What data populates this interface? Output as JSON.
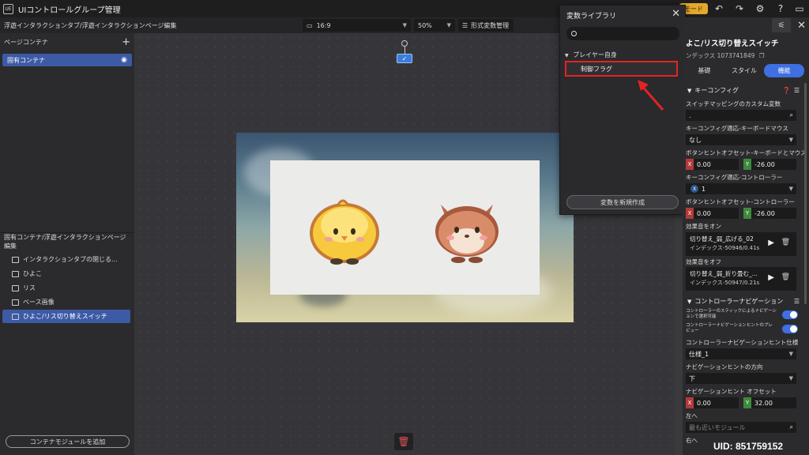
{
  "titlebar": {
    "app_icon": "UE",
    "title": "UIコントロールグループ管理",
    "mode_chip": "モード"
  },
  "toolbar": {
    "breadcrumb": "浮遊インタラクションタブ/浮遊インタラクションページ編集",
    "aspect": "16:9",
    "zoom": "50%",
    "format_vars": "形式変数管理"
  },
  "left_panel": {
    "header": "ページコンテナ",
    "container_item": "固有コンテナ",
    "section2_header": "固有コンテナ/浮遊インタラクションページ編集",
    "tree_items": [
      "インタラクションタブの閉じる...",
      "ひよこ",
      "リス",
      "ベース画像",
      "ひよこ/リス切り替えスイッチ"
    ],
    "add_module": "コンテナモジュールを追加"
  },
  "var_library": {
    "title": "変数ライブラリ",
    "group": "プレイヤー自身",
    "item": "制御フラグ",
    "new_button": "変数を新規作成"
  },
  "right_panel": {
    "name": "よこ/リス切り替えスイッチ",
    "index": "ンデックス 1073741849",
    "tabs": [
      "基礎",
      "スタイル",
      "機能"
    ],
    "key_config": "キーコンフィグ",
    "custom_var_label": "スイッチマッピングのカスタム変数",
    "custom_var_value": ".",
    "kb_label": "キーコンフィグ適応-キーボードマウス",
    "kb_value": "なし",
    "kb_offset_label": "ボタンヒントオフセット-キーボードとマウス",
    "kb_offset_x": "0.00",
    "kb_offset_y": "-26.00",
    "ctrl_label": "キーコンフィグ適応-コントローラー",
    "ctrl_value": "1",
    "ctrl_offset_label": "ボタンヒントオフセット-コントローラー",
    "ctrl_offset_x": "0.00",
    "ctrl_offset_y": "-26.00",
    "sound_on_label": "効果音をオン",
    "sound_on_name": "切り替え_弱_広げる_02",
    "sound_on_sub": "インデックス-50946/0.41s",
    "sound_off_label": "効果音をオフ",
    "sound_off_name": "切り替え_弱_折り畳む_...",
    "sound_off_sub": "インデックス-50947/0.21s",
    "ctrl_nav": "コントローラーナビゲーション",
    "nav_toggle1": "コントローラーのスティックによるナビゲーションで選択可能",
    "nav_toggle2": "コントローラーナビゲーションヒントのプレビュー",
    "hint_style_label": "コントローラーナビゲーションヒント仕様",
    "hint_style_value": "仕様_1",
    "hint_dir_label": "ナビゲーションヒントの方向",
    "hint_dir_value": "下",
    "hint_offset_label": "ナビゲーションヒント オフセット",
    "hint_offset_x": "0.00",
    "hint_offset_y": "32.00",
    "left_label": "左へ",
    "nearest_placeholder": "最も近いモジュール",
    "right_label": "右へ",
    "axis_x": "X",
    "axis_y": "Y"
  },
  "footer": {
    "uid": "UID: 851759152"
  },
  "colors": {
    "accent": "#3f6fe0",
    "selection": "#3d5aa5",
    "highlight_red": "#e62222",
    "mode_chip": "#e6a82a"
  }
}
